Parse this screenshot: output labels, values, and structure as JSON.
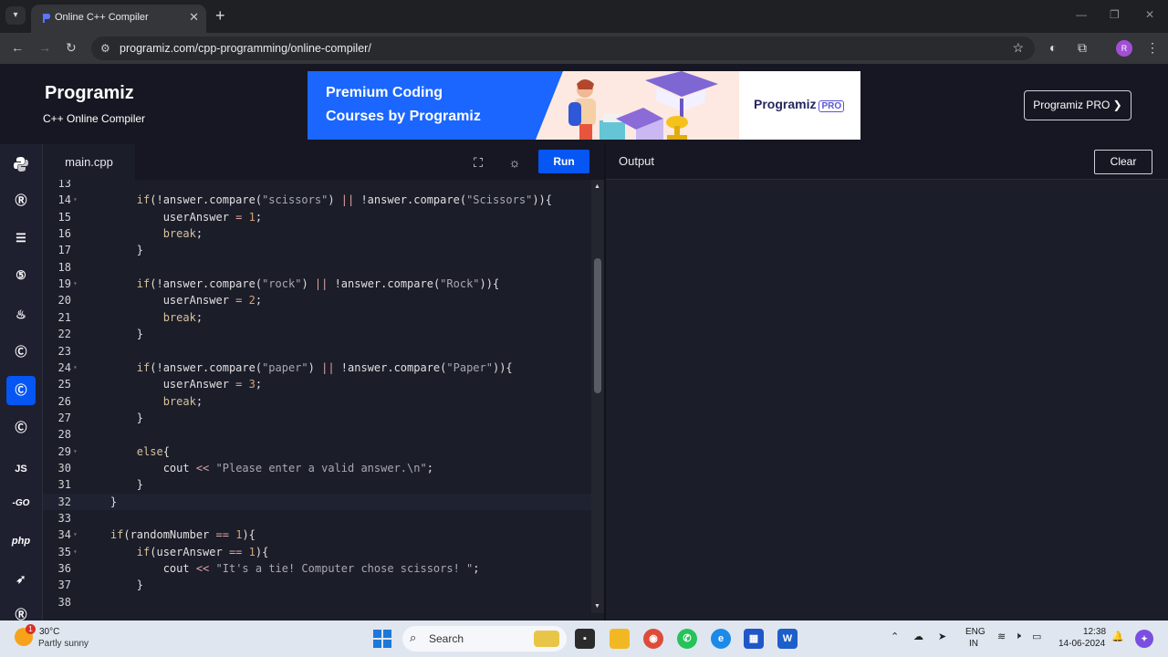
{
  "browser": {
    "tab_title": "Online C++ Compiler",
    "url": "programiz.com/cpp-programming/online-compiler/",
    "profile_initial": "R"
  },
  "header": {
    "logo": "Programiz",
    "subtitle": "C++ Online Compiler",
    "banner_line1": "Premium Coding",
    "banner_line2": "Courses by Programiz",
    "banner_brand": "Programiz",
    "banner_pro": "PRO",
    "pro_button": "Programiz PRO ❯"
  },
  "sidebar": {
    "items": [
      {
        "icon": "python-icon",
        "glyph": "🐍"
      },
      {
        "icon": "r-icon",
        "glyph": "R"
      },
      {
        "icon": "sql-database-icon",
        "glyph": "≣"
      },
      {
        "icon": "html5-icon",
        "glyph": "5"
      },
      {
        "icon": "java-icon",
        "glyph": "♨"
      },
      {
        "icon": "c-icon",
        "glyph": "C"
      },
      {
        "icon": "cpp-icon",
        "glyph": "C"
      },
      {
        "icon": "csharp-icon",
        "glyph": "C"
      },
      {
        "icon": "javascript-icon",
        "glyph": "JS"
      },
      {
        "icon": "go-icon",
        "glyph": "GO"
      },
      {
        "icon": "php-icon",
        "glyph": "php"
      },
      {
        "icon": "swift-icon",
        "glyph": "➶"
      },
      {
        "icon": "rust-icon",
        "glyph": "R"
      }
    ],
    "active_index": 6
  },
  "editor": {
    "file_name": "main.cpp",
    "run_label": "Run",
    "lines": [
      {
        "n": "13",
        "fold": false,
        "html": ""
      },
      {
        "n": "14",
        "fold": true,
        "html": "        <span class=\"kw\">if</span>(!answer.compare(<span class=\"str\">\"scissors\"</span>) <span class=\"op\">||</span> !answer.compare(<span class=\"str\">\"Scissors\"</span>)){"
      },
      {
        "n": "15",
        "fold": false,
        "html": "            userAnswer <span class=\"op\">=</span> <span class=\"num\">1</span>;"
      },
      {
        "n": "16",
        "fold": false,
        "html": "            <span class=\"kw\">break</span>;"
      },
      {
        "n": "17",
        "fold": false,
        "html": "        }"
      },
      {
        "n": "18",
        "fold": false,
        "html": ""
      },
      {
        "n": "19",
        "fold": true,
        "html": "        <span class=\"kw\">if</span>(!answer.compare(<span class=\"str\">\"rock\"</span>) <span class=\"op\">||</span> !answer.compare(<span class=\"str\">\"Rock\"</span>)){"
      },
      {
        "n": "20",
        "fold": false,
        "html": "            userAnswer <span class=\"op\">=</span> <span class=\"num\">2</span>;"
      },
      {
        "n": "21",
        "fold": false,
        "html": "            <span class=\"kw\">break</span>;"
      },
      {
        "n": "22",
        "fold": false,
        "html": "        }"
      },
      {
        "n": "23",
        "fold": false,
        "html": ""
      },
      {
        "n": "24",
        "fold": true,
        "html": "        <span class=\"kw\">if</span>(!answer.compare(<span class=\"str\">\"paper\"</span>) <span class=\"op\">||</span> !answer.compare(<span class=\"str\">\"Paper\"</span>)){"
      },
      {
        "n": "25",
        "fold": false,
        "html": "            userAnswer <span class=\"op\">=</span> <span class=\"num\">3</span>;"
      },
      {
        "n": "26",
        "fold": false,
        "html": "            <span class=\"kw\">break</span>;"
      },
      {
        "n": "27",
        "fold": false,
        "html": "        }"
      },
      {
        "n": "28",
        "fold": false,
        "html": ""
      },
      {
        "n": "29",
        "fold": true,
        "html": "        <span class=\"kw\">else</span>{"
      },
      {
        "n": "30",
        "fold": false,
        "html": "            cout <span class=\"op\">&lt;&lt;</span> <span class=\"str\">\"Please enter a valid answer.\\n\"</span>;"
      },
      {
        "n": "31",
        "fold": false,
        "html": "        }"
      },
      {
        "n": "32",
        "fold": false,
        "html": "    }",
        "current": true
      },
      {
        "n": "33",
        "fold": false,
        "html": ""
      },
      {
        "n": "34",
        "fold": true,
        "html": "    <span class=\"kw\">if</span>(randomNumber <span class=\"op\">==</span> <span class=\"num\">1</span>){"
      },
      {
        "n": "35",
        "fold": true,
        "html": "        <span class=\"kw\">if</span>(userAnswer <span class=\"op\">==</span> <span class=\"num\">1</span>){"
      },
      {
        "n": "36",
        "fold": false,
        "html": "            cout <span class=\"op\">&lt;&lt;</span> <span class=\"str\">\"It's a tie! Computer chose scissors! \"</span>;"
      },
      {
        "n": "37",
        "fold": false,
        "html": "        }"
      },
      {
        "n": "38",
        "fold": false,
        "html": ""
      }
    ]
  },
  "output": {
    "title": "Output",
    "clear_label": "Clear"
  },
  "taskbar": {
    "weather_badge": "1",
    "temperature": "30°C",
    "weather": "Partly sunny",
    "search_placeholder": "Search",
    "lang_top": "ENG",
    "lang_bottom": "IN",
    "time": "12:38",
    "date": "14-06-2024"
  },
  "colors": {
    "accent": "#0556f3",
    "editor_bg": "#1b1d29",
    "header_bg": "#161722"
  }
}
